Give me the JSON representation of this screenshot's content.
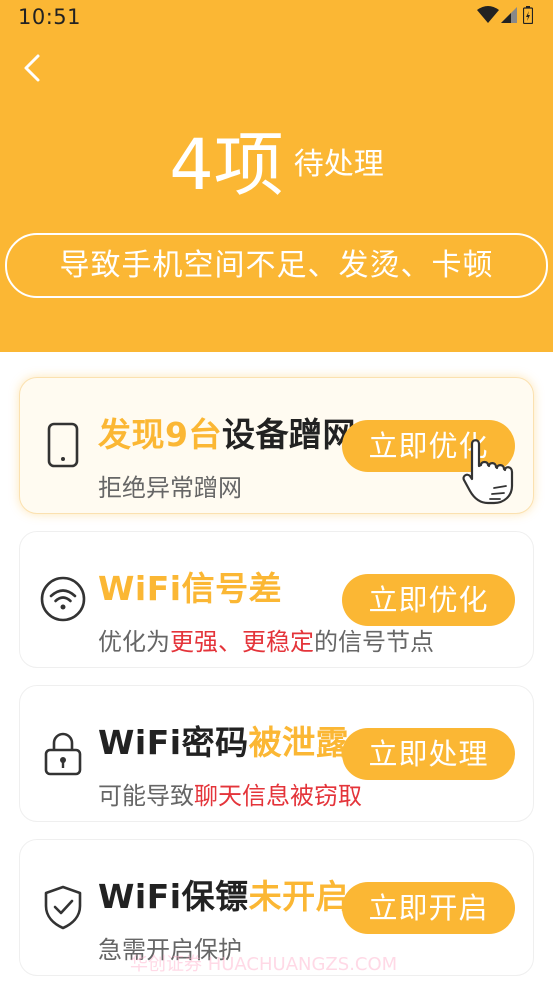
{
  "status_bar": {
    "time": "10:51"
  },
  "header": {
    "count": "4项",
    "count_unit": "待处理",
    "subtitle": "导致手机空间不足、发烫、卡顿"
  },
  "cards": [
    {
      "title_highlight": "发现9台",
      "title_rest": "设备蹭网",
      "sub": "拒绝异常蹭网",
      "button": "立即优化",
      "icon": "phone-icon"
    },
    {
      "title_highlight": "WiFi信号差",
      "sub_a": "优化为",
      "sub_b": "更强、更稳定",
      "sub_c": "的信号节点",
      "button": "立即优化",
      "icon": "wifi-icon"
    },
    {
      "title_rest": "WiFi密码",
      "title_highlight": "被泄露",
      "sub_a": "可能导致",
      "sub_b": "聊天信息被窃取",
      "button": "立即处理",
      "icon": "lock-icon"
    },
    {
      "title_rest": "WiFi保镖",
      "title_highlight": "未开启",
      "sub": "急需开启保护",
      "button": "立即开启",
      "icon": "shield-check-icon"
    }
  ],
  "watermark": "华创证券 HUACHUANGZS.COM",
  "colors": {
    "accent": "#FBB734",
    "alert": "#E4343A",
    "text": "#222222",
    "muted": "#666666"
  }
}
